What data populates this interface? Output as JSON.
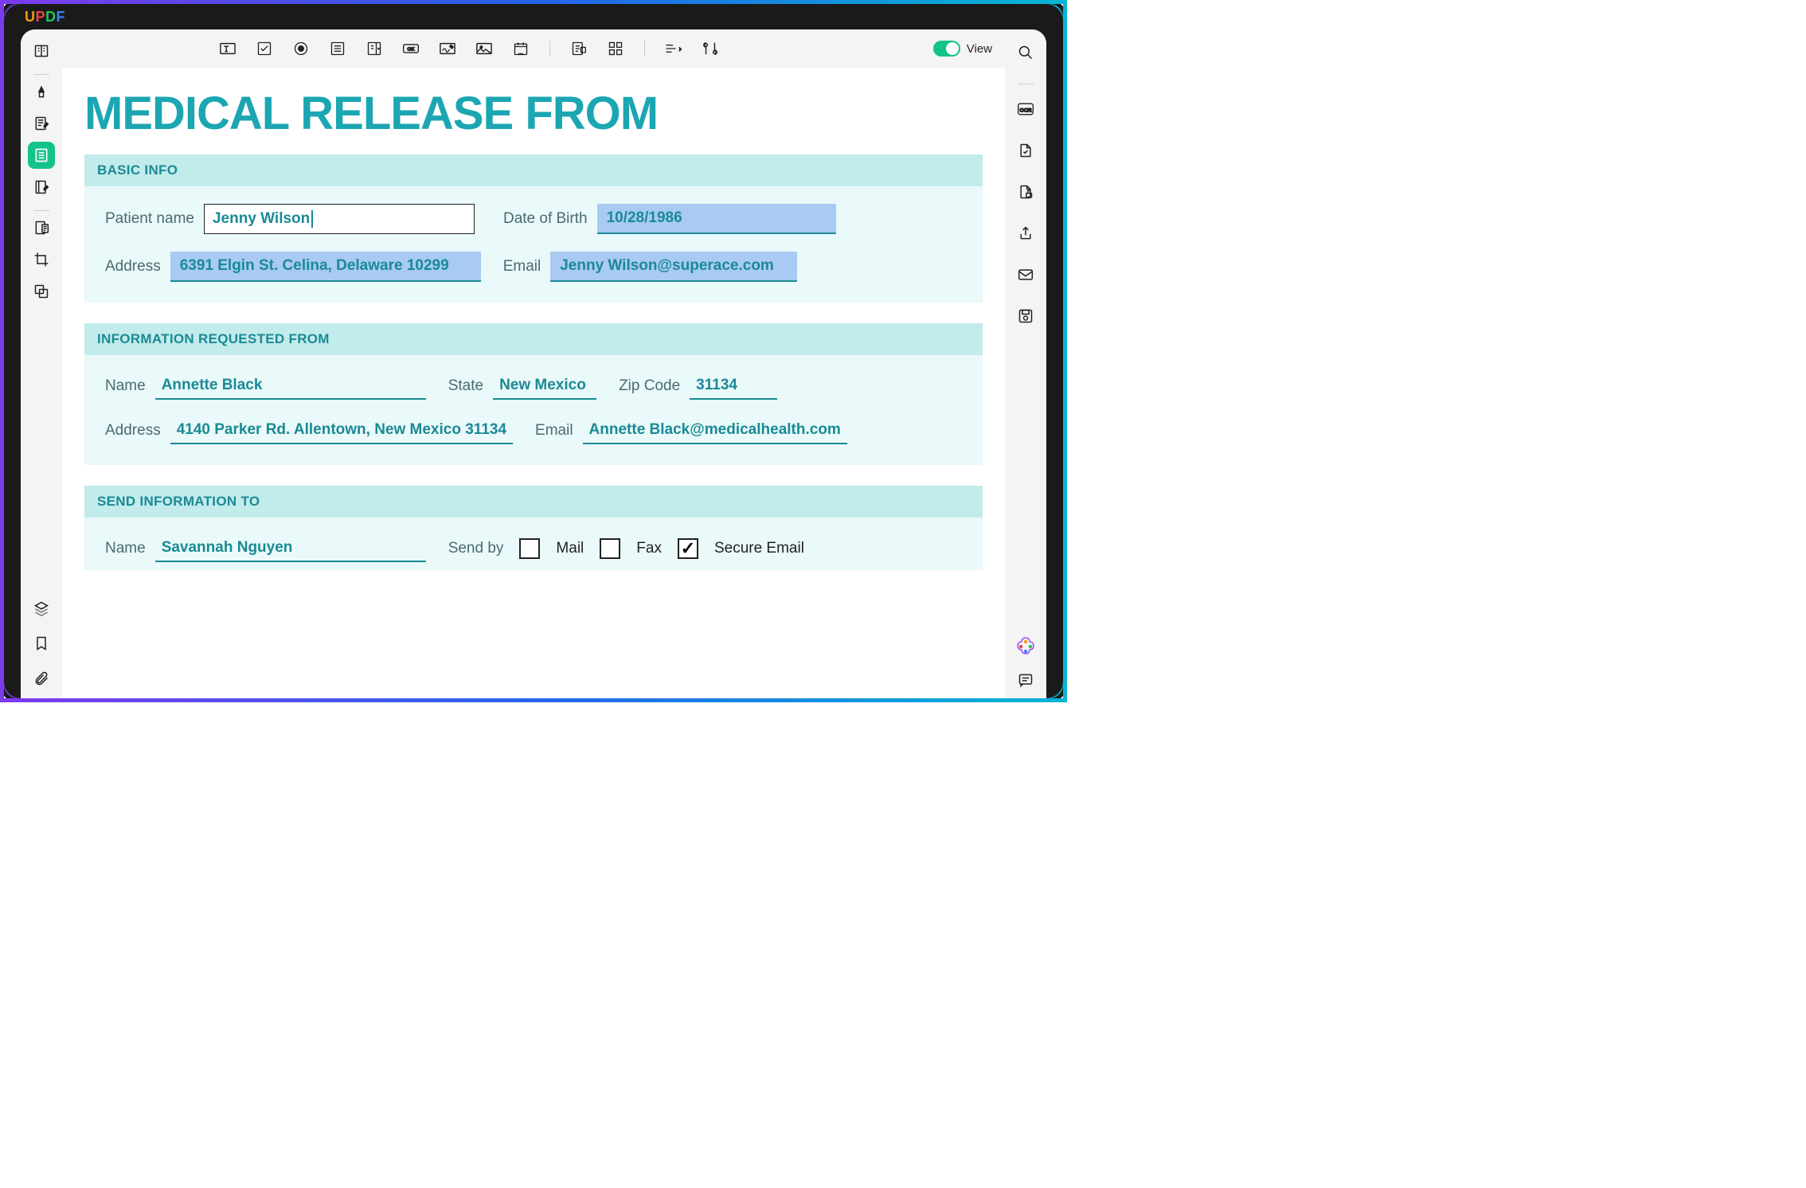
{
  "app": {
    "logo": "UPDF",
    "view_label": "View"
  },
  "left_rail": {
    "items": [
      "reader",
      "edit-pencil",
      "form-page",
      "forms",
      "page-edit",
      "clipboard",
      "crop",
      "compare"
    ],
    "footer": [
      "layers",
      "bookmark",
      "clip"
    ]
  },
  "toolbar": {
    "items": [
      "text-field",
      "checkbox",
      "radio",
      "list-box",
      "combo-box",
      "button",
      "signature",
      "image",
      "date",
      "form-properties",
      "grid-select",
      "align",
      "form-tools"
    ]
  },
  "right_rail": {
    "items": [
      "search",
      "ocr",
      "page-setup",
      "protect",
      "share",
      "email",
      "save"
    ]
  },
  "doc": {
    "title": "MEDICAL RELEASE FROM",
    "basic_info": {
      "header": "BASIC INFO",
      "patient_label": "Patient name",
      "patient_value": "Jenny Wilson",
      "dob_label": "Date of Birth",
      "dob_value": "10/28/1986",
      "address_label": "Address",
      "address_value": "6391 Elgin St. Celina, Delaware 10299",
      "email_label": "Email",
      "email_value": "Jenny Wilson@superace.com"
    },
    "requested_from": {
      "header": "INFORMATION REQUESTED FROM",
      "name_label": "Name",
      "name_value": "Annette Black",
      "state_label": "State",
      "state_value": "New Mexico",
      "zip_label": "Zip Code",
      "zip_value": "31134",
      "address_label": "Address",
      "address_value": "4140 Parker Rd. Allentown, New Mexico 31134",
      "email_label": "Email",
      "email_value": "Annette Black@medicalhealth.com"
    },
    "send_to": {
      "header": "SEND INFORMATION TO",
      "name_label": "Name",
      "name_value": "Savannah Nguyen",
      "send_by_label": "Send by",
      "mail_label": "Mail",
      "fax_label": "Fax",
      "secure_label": "Secure Email",
      "mail_checked": false,
      "fax_checked": false,
      "secure_checked": true
    }
  }
}
